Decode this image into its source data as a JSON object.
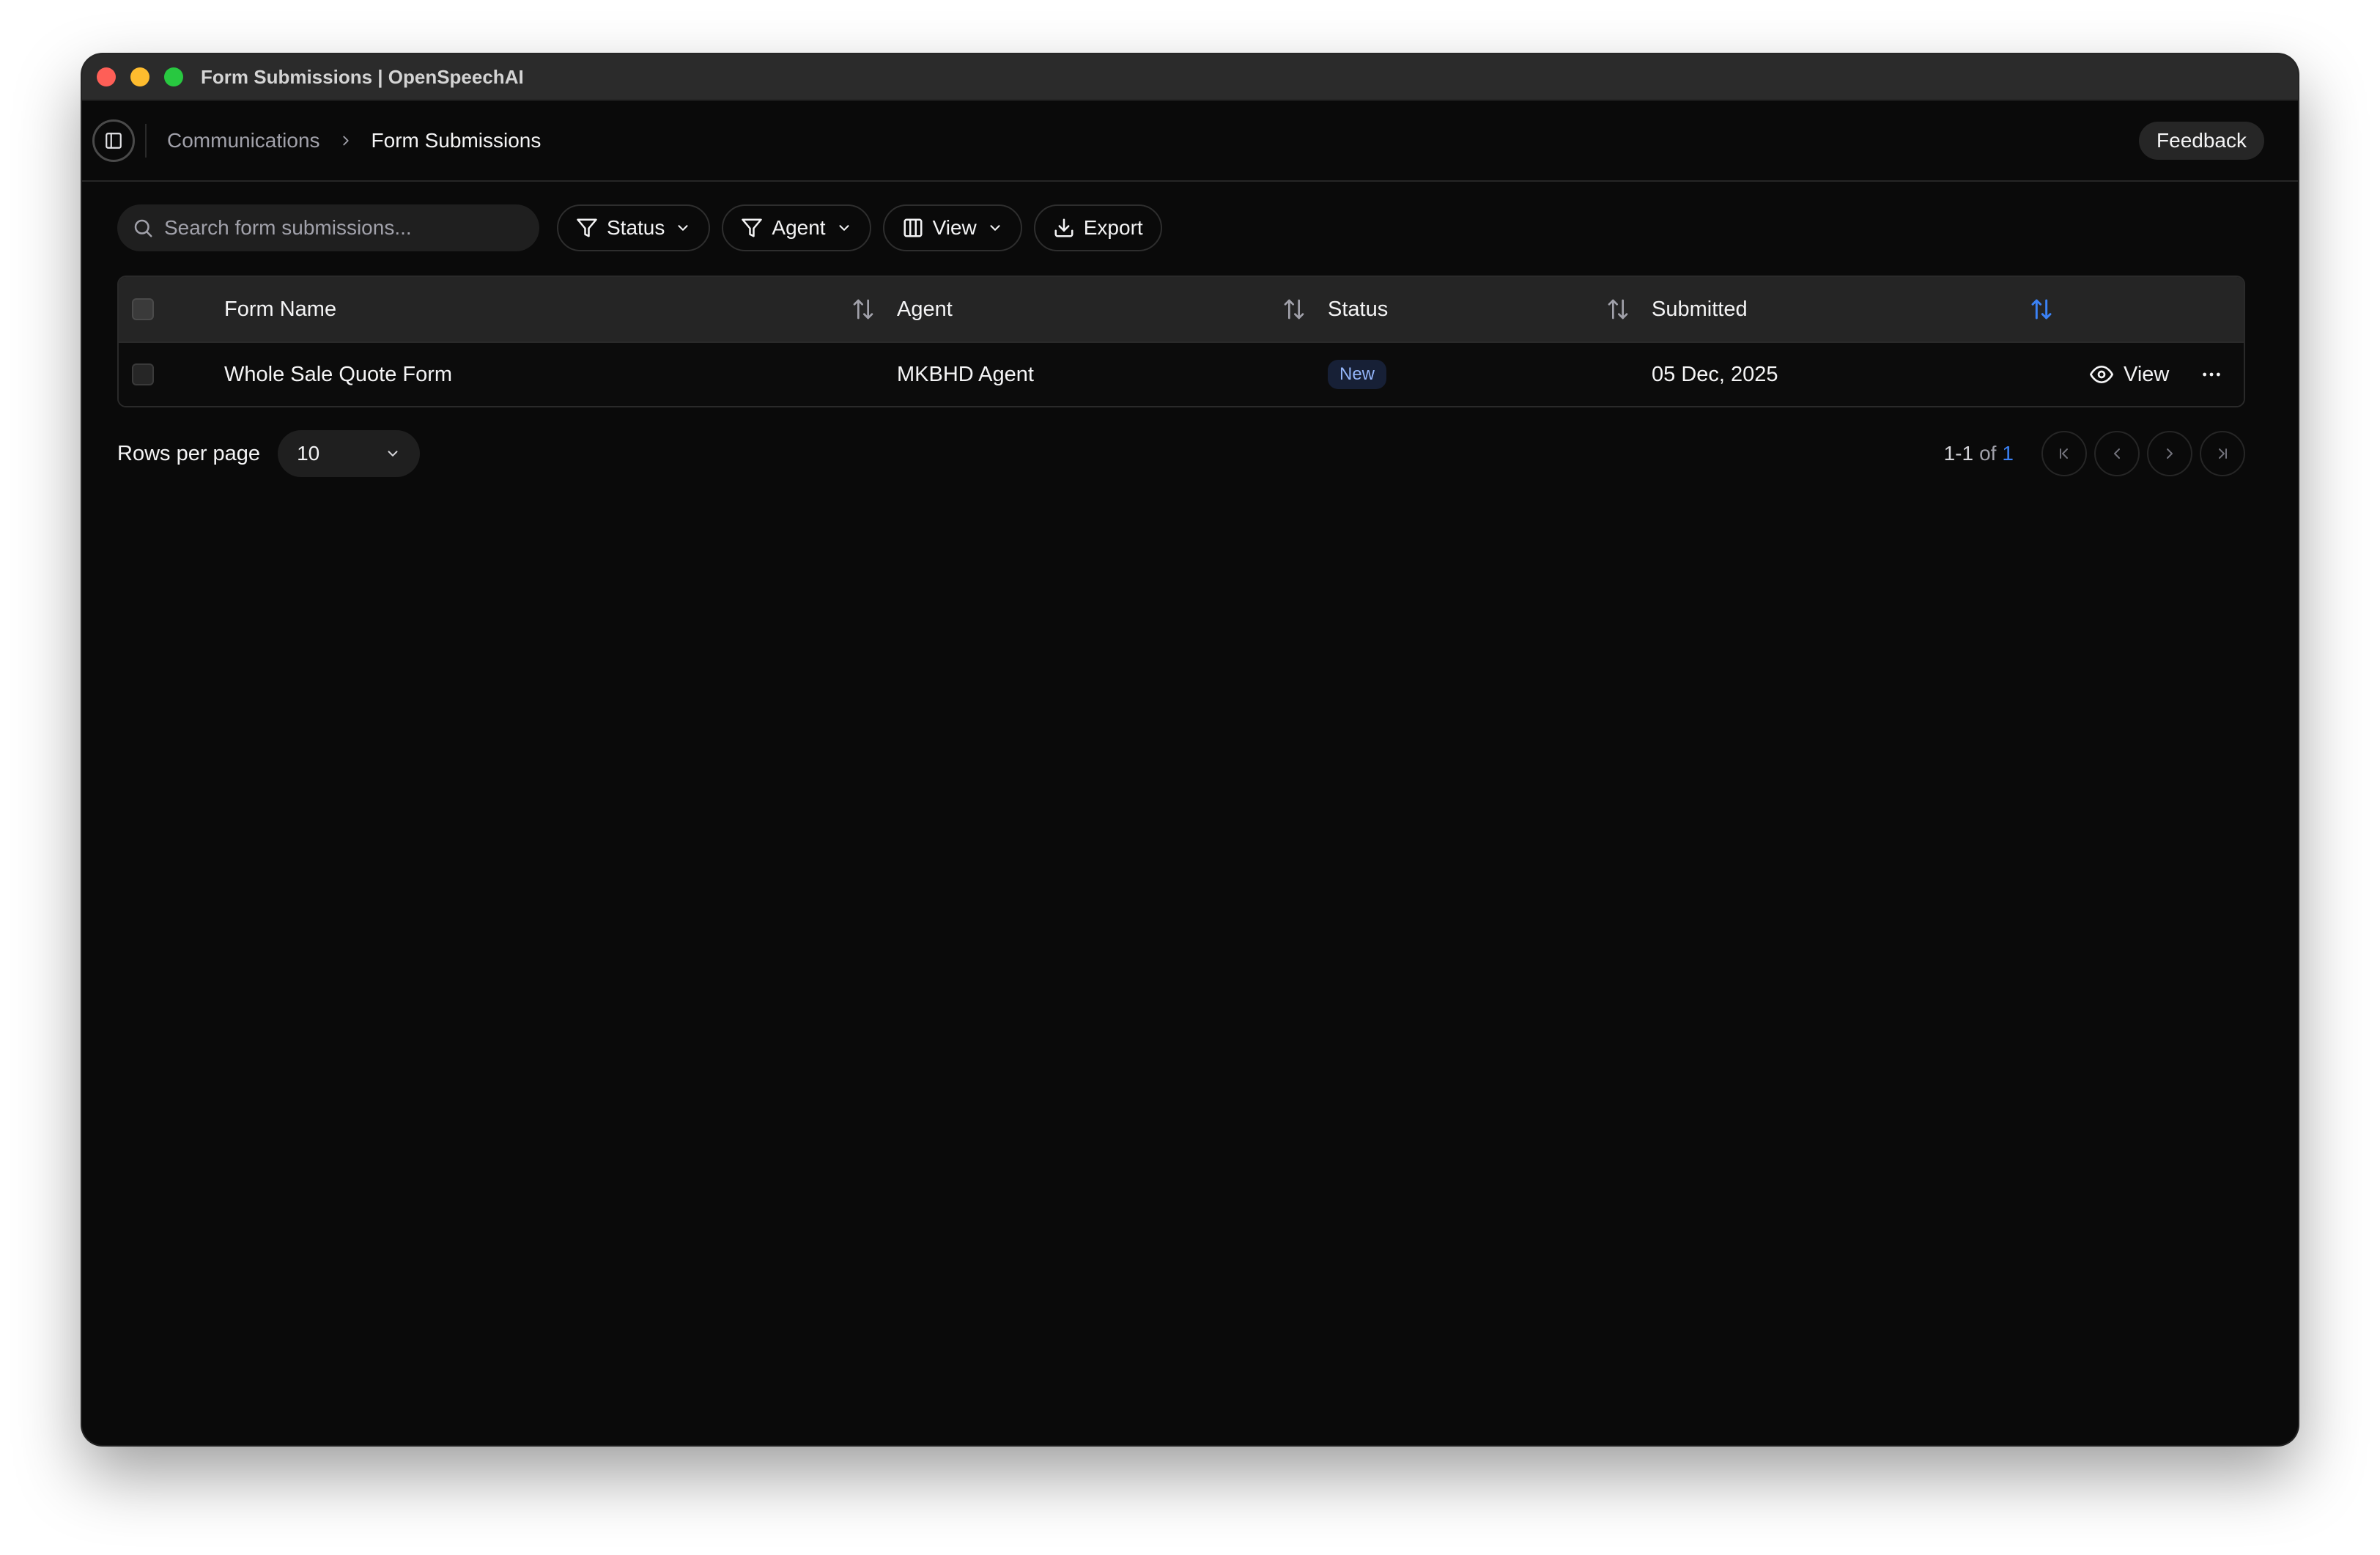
{
  "window": {
    "title": "Form Submissions | OpenSpeechAI"
  },
  "breadcrumb": {
    "parent": "Communications",
    "current": "Form Submissions"
  },
  "header": {
    "feedback_label": "Feedback"
  },
  "toolbar": {
    "search_placeholder": "Search form submissions...",
    "search_value": "",
    "status_label": "Status",
    "agent_label": "Agent",
    "view_label": "View",
    "export_label": "Export"
  },
  "table": {
    "columns": [
      "Form Name",
      "Agent",
      "Status",
      "Submitted"
    ],
    "active_sort_column": "Submitted",
    "rows": [
      {
        "form_name": "Whole Sale Quote Form",
        "agent": "MKBHD Agent",
        "status": "New",
        "submitted": "05 Dec, 2025",
        "view_label": "View"
      }
    ]
  },
  "pagination": {
    "rows_per_page_label": "Rows per page",
    "rows_per_page_value": "10",
    "range": "1-1",
    "of": "of",
    "total": "1"
  },
  "colors": {
    "accent": "#3b82f6",
    "badge_bg": "#172036",
    "badge_text": "#93b4f8",
    "background": "#0a0a0a"
  },
  "icons": {
    "sidebar_toggle": "sidebar-panel-icon",
    "breadcrumb_sep": "chevron-right-icon",
    "search": "search-icon",
    "filter": "filter-icon",
    "columns": "columns-icon",
    "download": "download-icon",
    "sort": "arrow-up-down-icon",
    "eye": "eye-icon",
    "more": "more-horizontal-icon"
  }
}
